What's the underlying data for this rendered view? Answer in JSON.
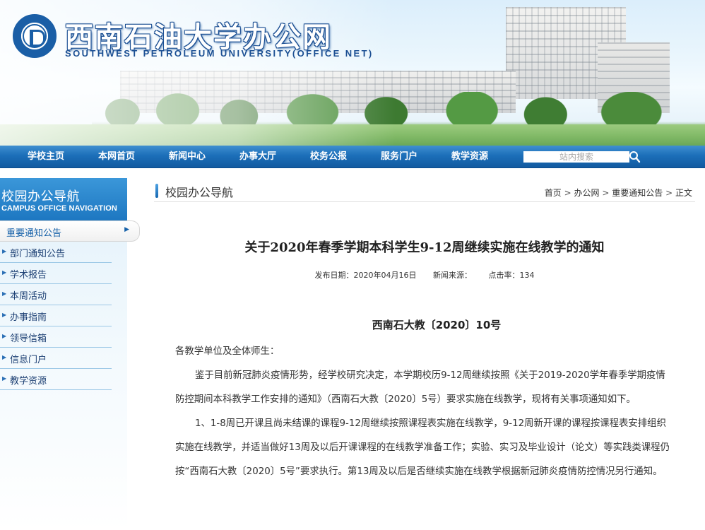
{
  "header": {
    "title": "西南石油大学办公网",
    "subtitle": "SOUTHWEST PETROLEUM UNIVERSITY(OFFICE NET)"
  },
  "nav": {
    "items": [
      "学校主页",
      "本网首页",
      "新闻中心",
      "办事大厅",
      "校务公报",
      "服务门户",
      "教学资源"
    ],
    "search_placeholder": "站内搜索"
  },
  "sidebar": {
    "title_cn": "校园办公导航",
    "title_en": "CAMPUS OFFICE NAVIGATION",
    "active": "重要通知公告",
    "items": [
      "部门通知公告",
      "学术报告",
      "本周活动",
      "办事指南",
      "领导信箱",
      "信息门户",
      "教学资源"
    ]
  },
  "breadcrumb": {
    "section": "校园办公导航",
    "items": [
      "首页",
      "办公网",
      "重要通知公告",
      "正文"
    ],
    "separator": ">"
  },
  "article": {
    "title": "关于2020年春季学期本科学生9-12周继续实施在线教学的通知",
    "meta": {
      "date": "发布日期：2020年04月16日",
      "source": "新闻来源：",
      "hits": "点击率：134"
    },
    "doc_no": "西南石大教〔2020〕10号",
    "salutation": "各教学单位及全体师生：",
    "paragraph1": "鉴于目前新冠肺炎疫情形势，经学校研究决定，本学期校历9-12周继续按照《关于2019-2020学年春季学期疫情防控期间本科教学工作安排的通知》（西南石大教〔2020〕5号）要求实施在线教学，现将有关事项通知如下。",
    "paragraph2": "1、1-8周已开课且尚未结课的课程9-12周继续按照课程表实施在线教学，9-12周新开课的课程按课程表安排组织实施在线教学，并适当做好13周及以后开课课程的在线教学准备工作；实验、实习及毕业设计（论文）等实践类课程仍按“西南石大教〔2020〕5号”要求执行。第13周及以后是否继续实施在线教学根据新冠肺炎疫情防控情况另行通知。"
  },
  "colors": {
    "nav_blue": "#1c6fb9",
    "sidebar_blue": "#1d77c1",
    "link_blue": "#1560a8"
  }
}
